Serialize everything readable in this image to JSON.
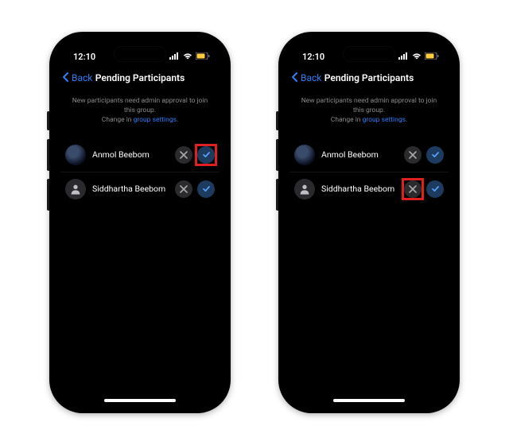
{
  "status": {
    "time": "12:10"
  },
  "nav": {
    "back": "Back",
    "title": "Pending Participants"
  },
  "info": {
    "line1": "New participants need admin approval to join this group.",
    "line2_prefix": "Change in ",
    "link": "group settings",
    "line2_suffix": "."
  },
  "participants": [
    {
      "name": "Anmol Beebom"
    },
    {
      "name": "Siddhartha Beebom"
    }
  ]
}
